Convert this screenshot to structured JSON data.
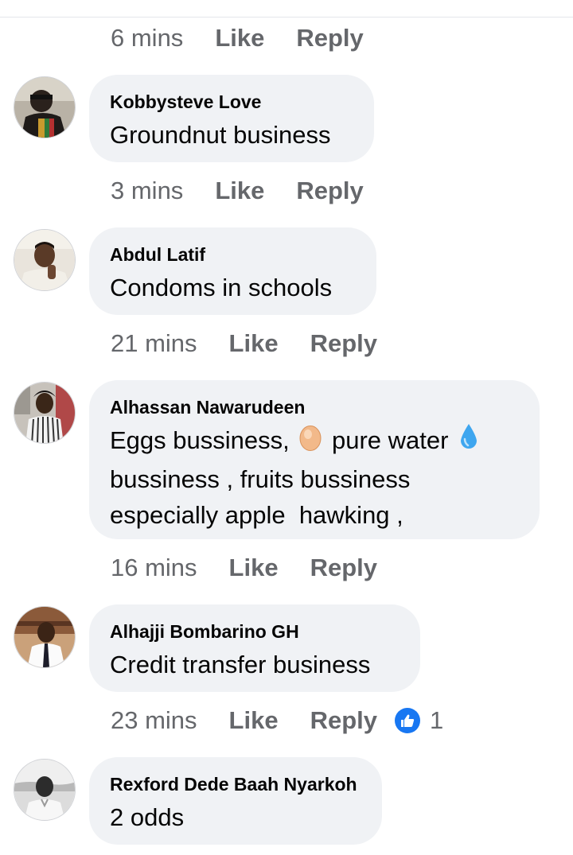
{
  "labels": {
    "like": "Like",
    "reply": "Reply"
  },
  "top_meta": {
    "time": "6 mins"
  },
  "comments": [
    {
      "author": "Kobbysteve Love",
      "text": "Groundnut business",
      "time": "3 mins"
    },
    {
      "author": "Abdul Latif",
      "text": "Condoms in schools",
      "time": "21 mins"
    },
    {
      "author": "Alhassan Nawarudeen",
      "text_parts": [
        "Eggs bussiness, ",
        " pure water ",
        "bussiness , fruits bussiness",
        "especially apple  hawking ,"
      ],
      "emojis": [
        "egg-emoji",
        "droplet-emoji"
      ],
      "time": "16 mins"
    },
    {
      "author": "Alhajji Bombarino GH",
      "text": "Credit transfer business",
      "time": "23 mins",
      "reaction": {
        "icon": "like-reaction-icon",
        "count": "1"
      }
    },
    {
      "author": "Rexford Dede Baah Nyarkoh",
      "text": "2 odds"
    }
  ],
  "colors": {
    "bubble": "#f0f2f5",
    "meta_text": "#65676b",
    "like_blue": "#1877f2"
  }
}
